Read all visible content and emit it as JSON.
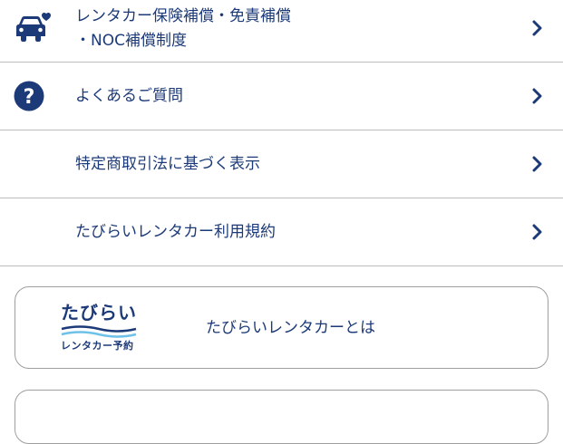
{
  "menu": {
    "items": [
      {
        "label_line1": "レンタカー保険補償・免責補償",
        "label_line2": "・NOC補償制度",
        "icon": "car-heart-icon"
      },
      {
        "label": "よくあるご質問",
        "icon": "question-icon"
      },
      {
        "label": "特定商取引法に基づく表示"
      },
      {
        "label": "たびらいレンタカー利用規約"
      }
    ]
  },
  "about_card": {
    "logo_title": "たびらい",
    "logo_subtitle": "レンタカー予約",
    "label": "たびらいレンタカーとは"
  },
  "colors": {
    "navy": "#1c3a78",
    "divider": "#bdbdbd",
    "logo_wave": "#6ec1e8"
  }
}
